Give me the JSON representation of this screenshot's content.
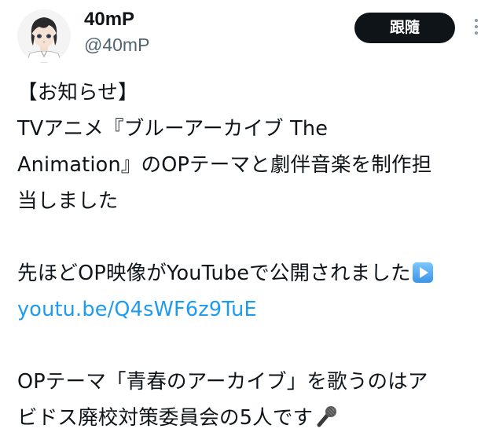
{
  "author": {
    "display_name": "40mP",
    "handle": "@40mP",
    "avatar_icon": "avatar-anime-character"
  },
  "header": {
    "follow_label": "跟隨",
    "more_icon": "more-vertical-icon"
  },
  "tweet": {
    "line1": "【お知らせ】",
    "line2": "TVアニメ『ブルーアーカイブ The",
    "line3": "Animation』のOPテーマと劇伴音楽を制作担",
    "line4": "当しました",
    "line5": "先ほどOP映像がYouTubeで公開されました",
    "link": "youtu.be/Q4sWF6z9TuE",
    "line6": "OPテーマ「青春のアーカイブ」を歌うのはア",
    "line7": "ビドス廃校対策委員会の5人です",
    "emoji_play": "play-button-emoji",
    "emoji_mic": "microphone-emoji"
  },
  "colors": {
    "text": "#0f1419",
    "secondary": "#536471",
    "link": "#1d9bf0",
    "button_bg": "#0f1419",
    "button_text": "#ffffff"
  }
}
